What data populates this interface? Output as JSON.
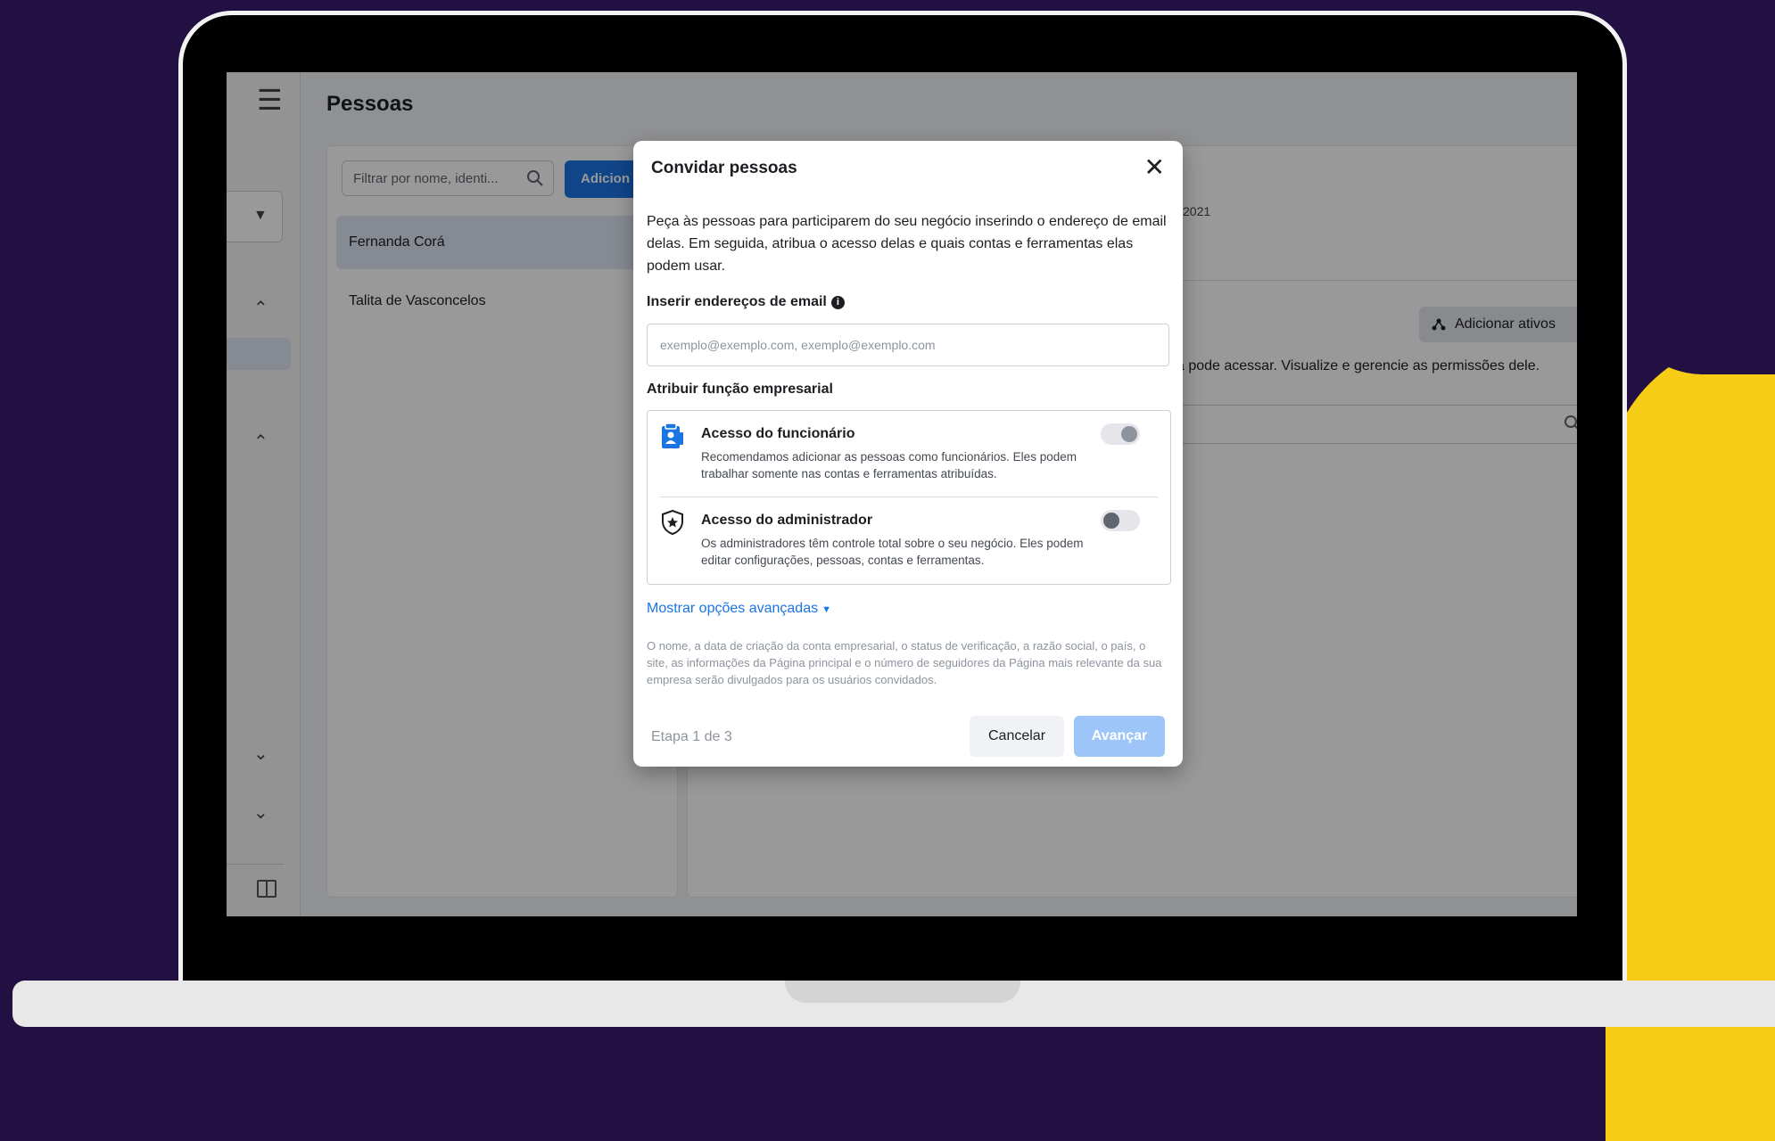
{
  "app": {
    "page_title": "Pessoas",
    "filter_placeholder": "Filtrar por nome, identi...",
    "add_button": "Adicion",
    "people": [
      "Fernanda Corá",
      "Talita de Vasconcelos"
    ],
    "detail": {
      "date_fragment": "2021",
      "add_assets_button": "Adicionar ativos",
      "description_fragment": "á pode acessar. Visualize e gerencie as permissões dele."
    }
  },
  "dialog": {
    "title": "Convidar pessoas",
    "intro": "Peça às pessoas para participarem do seu negócio inserindo o endereço de email delas. Em seguida, atribua o acesso delas e quais contas e ferramentas elas podem usar.",
    "email_label": "Inserir endereços de email",
    "email_placeholder": "exemplo@exemplo.com, exemplo@exemplo.com",
    "role_label": "Atribuir função empresarial",
    "roles": [
      {
        "title": "Acesso do funcionário",
        "description": "Recomendamos adicionar as pessoas como funcionários. Eles podem trabalhar somente nas contas e ferramentas atribuídas.",
        "toggle": "on",
        "icon": "employee-badge-icon"
      },
      {
        "title": "Acesso do administrador",
        "description": "Os administradores têm controle total sobre o seu negócio. Eles podem editar configurações, pessoas, contas e ferramentas.",
        "toggle": "off",
        "icon": "admin-shield-icon"
      }
    ],
    "advanced_link": "Mostrar opções avançadas",
    "disclaimer": "O nome, a data de criação da conta empresarial, o status de verificação, a razão social, o país, o site, as informações da Página principal e o número de seguidores da Página mais relevante da sua empresa serão divulgados para os usuários convidados.",
    "step": "Etapa 1 de 3",
    "cancel": "Cancelar",
    "next": "Avançar"
  },
  "colors": {
    "background": "#231042",
    "accent_yellow": "#f6cd14",
    "primary_blue": "#1b74e4",
    "disabled_blue": "#9ec5f8"
  }
}
